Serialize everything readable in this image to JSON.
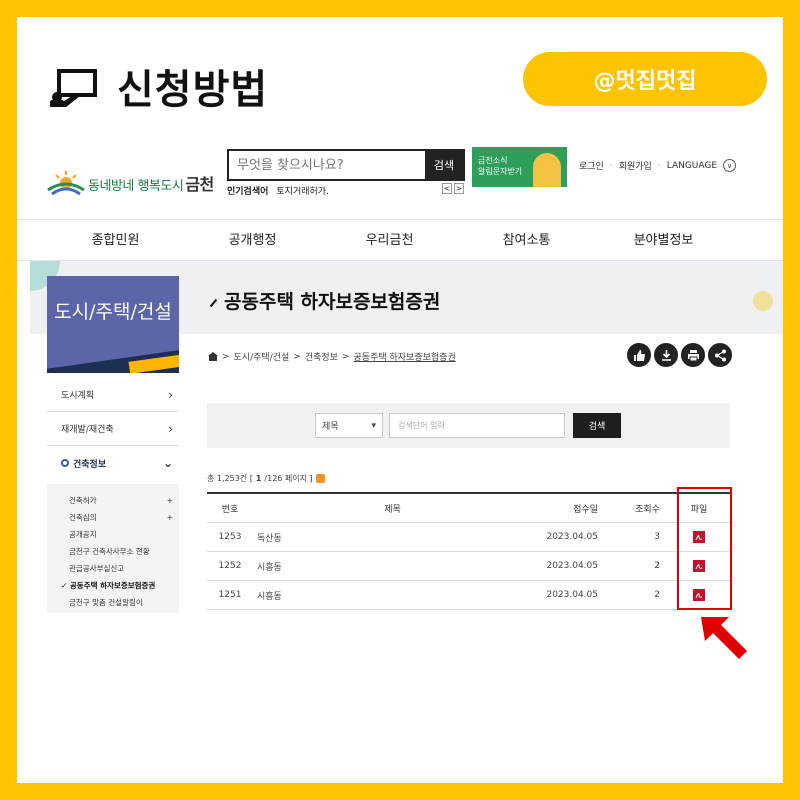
{
  "card": {
    "title": "신청방법",
    "handle": "@멋집멋집",
    "title_icon": "presentation-icon"
  },
  "site": {
    "logo_text": "동네방네 행복도시",
    "logo_city": "금천",
    "search": {
      "placeholder": "무엇을 찾으시나요?",
      "button": "검색"
    },
    "popular_label": "인기검색어",
    "popular_term": "토지거래허가.",
    "banner_line1": "금천소식",
    "banner_line2": "알림문자받기",
    "top_links": [
      "로그인",
      "회원가입",
      "LANGUAGE"
    ],
    "gnb": [
      "종합민원",
      "공개행정",
      "우리금천",
      "참여소통",
      "분야별정보"
    ],
    "side_title": "도시/주택/건설",
    "page_title": "공동주택 하자보증보험증권",
    "breadcrumb": [
      "도시/주택/건설",
      "건축정보",
      "공동주택 하자보증보험증권"
    ],
    "snb": [
      {
        "label": "도시계획"
      },
      {
        "label": "재개발/재건축"
      },
      {
        "label": "건축정보"
      }
    ],
    "snb_sub": [
      {
        "label": "건축허가",
        "plus": "+"
      },
      {
        "label": "건축심의",
        "plus": "+"
      },
      {
        "label": "공개공지",
        "plus": ""
      },
      {
        "label": "금천구 건축사사무소 현황",
        "plus": ""
      },
      {
        "label": "관급공사부실신고",
        "plus": ""
      },
      {
        "label": "공동주택 하자보증보험증권",
        "plus": ""
      },
      {
        "label": "금천구 맞춤 건설알림이",
        "plus": ""
      }
    ],
    "list_search": {
      "select": "제목",
      "placeholder": "검색단어 입력",
      "button": "검색"
    },
    "total_prefix": "총 1,253건 [",
    "page_current": "1",
    "page_suffix": "/126 페이지 ]",
    "table": {
      "headers": {
        "num": "번호",
        "title": "제목",
        "date": "접수일",
        "views": "조회수",
        "file": "파일"
      },
      "rows": [
        {
          "num": "1253",
          "title": "독산동",
          "date": "2023.04.05",
          "views": "3",
          "file_icon": "pdf-icon"
        },
        {
          "num": "1252",
          "title": "시흥동",
          "date": "2023.04.05",
          "views": "2",
          "file_icon": "pdf-icon"
        },
        {
          "num": "1251",
          "title": "시흥동",
          "date": "2023.04.05",
          "views": "2",
          "file_icon": "pdf-icon"
        }
      ]
    }
  },
  "colors": {
    "frame": "#ffc400",
    "side_accent": "#5b65a8",
    "highlight": "#e00000"
  }
}
